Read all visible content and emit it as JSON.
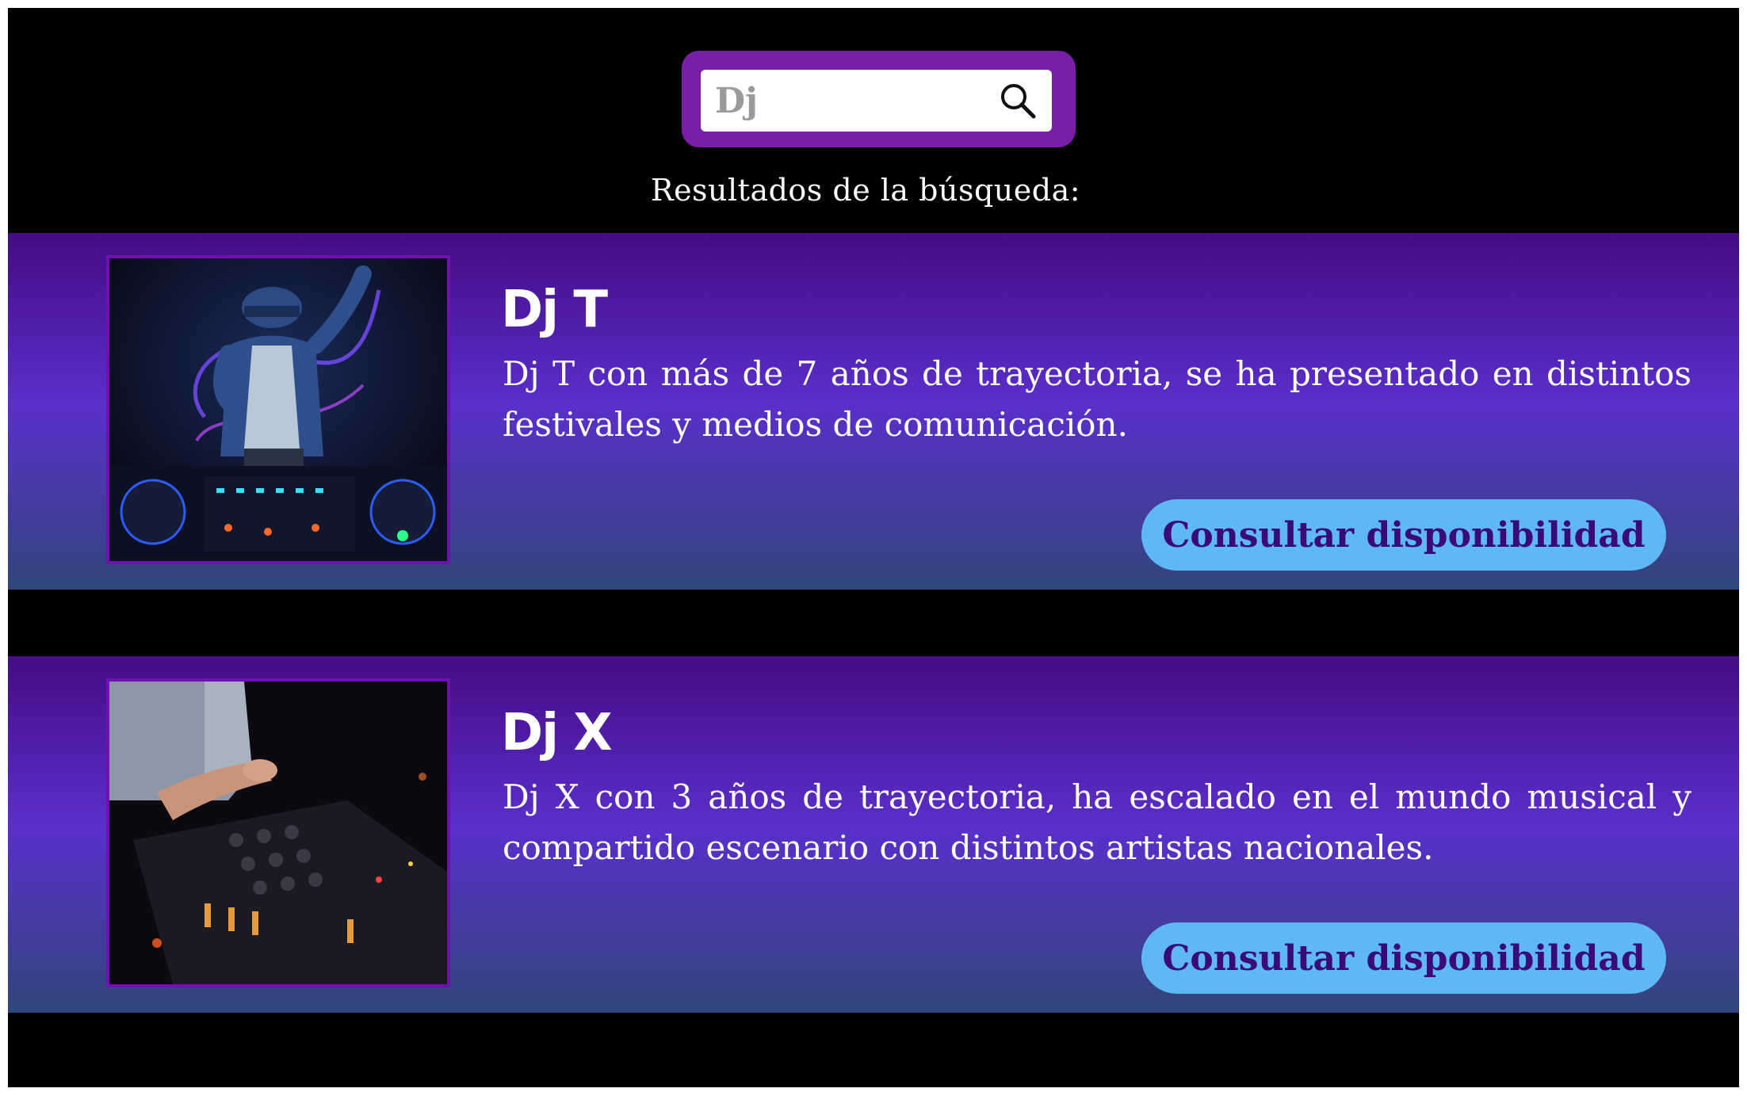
{
  "search": {
    "value": "Dj",
    "icon": "search-icon"
  },
  "results_heading": "Resultados de la búsqueda:",
  "results": [
    {
      "title": "Dj T",
      "description": "Dj T con más de 7 años de trayectoria, se ha presentado en distintos festivales y medios de comunicación.",
      "button_label": "Consultar disponibilidad",
      "image": "dj-dancing-photo"
    },
    {
      "title": "Dj X",
      "description": "Dj X con 3 años de trayectoria, ha escalado en el mundo musical y compartido escenario con distintos artistas nacionales.",
      "button_label": "Consultar disponibilidad",
      "image": "dj-mixer-photo"
    }
  ],
  "colors": {
    "background": "#000000",
    "search_frame": "#7a1ea8",
    "button": "#5fb8f3",
    "button_text": "#3a0b78",
    "card_top": "#440b84",
    "card_mid": "#5a2fcb",
    "card_bottom": "#30467a"
  }
}
